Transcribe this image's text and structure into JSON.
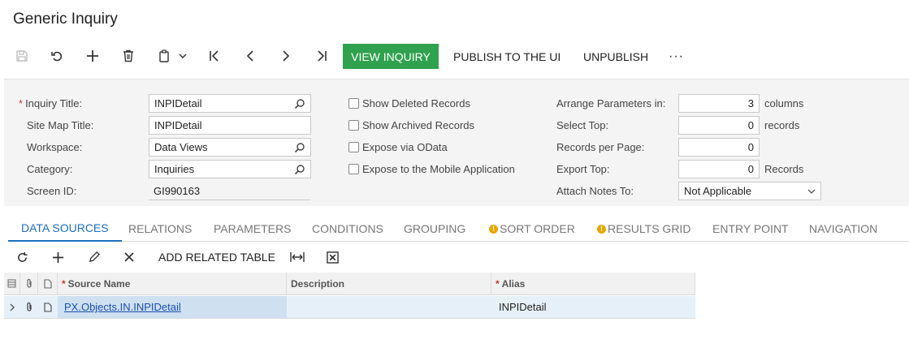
{
  "page": {
    "title": "Generic Inquiry"
  },
  "toolbar": {
    "icons": [
      "save-icon",
      "undo-icon",
      "add-icon",
      "delete-icon",
      "copy-paste-icon",
      "chevron-down-icon",
      "first-record-icon",
      "previous-record-icon",
      "next-record-icon",
      "last-record-icon",
      "more-icon"
    ],
    "view_inquiry": "VIEW INQUIRY",
    "publish": "PUBLISH TO THE UI",
    "unpublish": "UNPUBLISH",
    "more": "···",
    "accent": "#30a14e"
  },
  "form": {
    "inquiry_title": {
      "label": "Inquiry Title:",
      "required": "*",
      "value": "INPIDetail"
    },
    "site_map_title": {
      "label": "Site Map Title:",
      "value": "INPIDetail"
    },
    "workspace": {
      "label": "Workspace:",
      "value": "Data Views"
    },
    "category": {
      "label": "Category:",
      "value": "Inquiries"
    },
    "screen_id": {
      "label": "Screen ID:",
      "value": "GI990163"
    },
    "checkboxes": {
      "show_deleted": "Show Deleted Records",
      "show_archived": "Show Archived Records",
      "expose_odata": "Expose via OData",
      "expose_mobile": "Expose to the Mobile Application"
    },
    "arrange_params": {
      "label": "Arrange Parameters in:",
      "value": "3",
      "suffix": "columns"
    },
    "select_top": {
      "label": "Select Top:",
      "value": "0",
      "suffix": "records"
    },
    "records_per_page": {
      "label": "Records per Page:",
      "value": "0"
    },
    "export_top": {
      "label": "Export Top:",
      "value": "0",
      "suffix": "Records"
    },
    "attach_notes": {
      "label": "Attach Notes To:",
      "value": "Not Applicable"
    }
  },
  "tabs": [
    {
      "label": "DATA SOURCES",
      "active": true
    },
    {
      "label": "RELATIONS"
    },
    {
      "label": "PARAMETERS"
    },
    {
      "label": "CONDITIONS"
    },
    {
      "label": "GROUPING"
    },
    {
      "label": "SORT ORDER",
      "warning": true
    },
    {
      "label": "RESULTS GRID",
      "warning": true
    },
    {
      "label": "ENTRY POINT"
    },
    {
      "label": "NAVIGATION"
    }
  ],
  "grid_toolbar": {
    "add_related_table": "ADD RELATED TABLE"
  },
  "grid": {
    "columns": {
      "source_name": "Source Name",
      "description": "Description",
      "alias": "Alias",
      "required_mark": "*"
    },
    "rows": [
      {
        "source_name": "PX.Objects.IN.INPIDetail",
        "description": "",
        "alias": "INPIDetail"
      }
    ]
  },
  "warning_glyph": "!"
}
